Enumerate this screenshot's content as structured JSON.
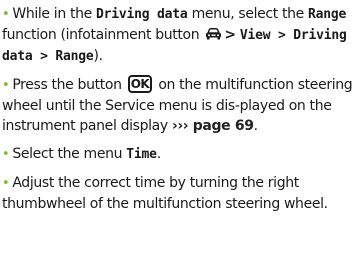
{
  "colors": {
    "bullet": "#78be20",
    "text": "#1a1a1a"
  },
  "icons": {
    "bullet": "bullet-point",
    "infotainment": "car-infotainment-icon",
    "ok_key": "ok-button-key"
  },
  "step1": {
    "bullet": "•",
    "text_a": "While in the ",
    "menu_code": "Driving data",
    "text_b": " menu, select the ",
    "function_code": "Range",
    "text_c": " function (infotainment button ",
    "gt1": ">",
    "view_code": "View > Driving data > Range",
    "text_d": ")."
  },
  "step2": {
    "bullet": "•",
    "text_a": "Press the button ",
    "ok_label": "OK",
    "text_b": " on the multifunction steering wheel until the Service menu is dis-played on the instrument panel display ",
    "link": "››› page 69",
    "text_c": "."
  },
  "step3": {
    "bullet": "•",
    "text_a": "Select the menu ",
    "menu_code": "Time",
    "text_b": "."
  },
  "step4": {
    "bullet": "•",
    "text": "Adjust the correct time by turning the right thumbwheel of the multifunction steering wheel."
  }
}
